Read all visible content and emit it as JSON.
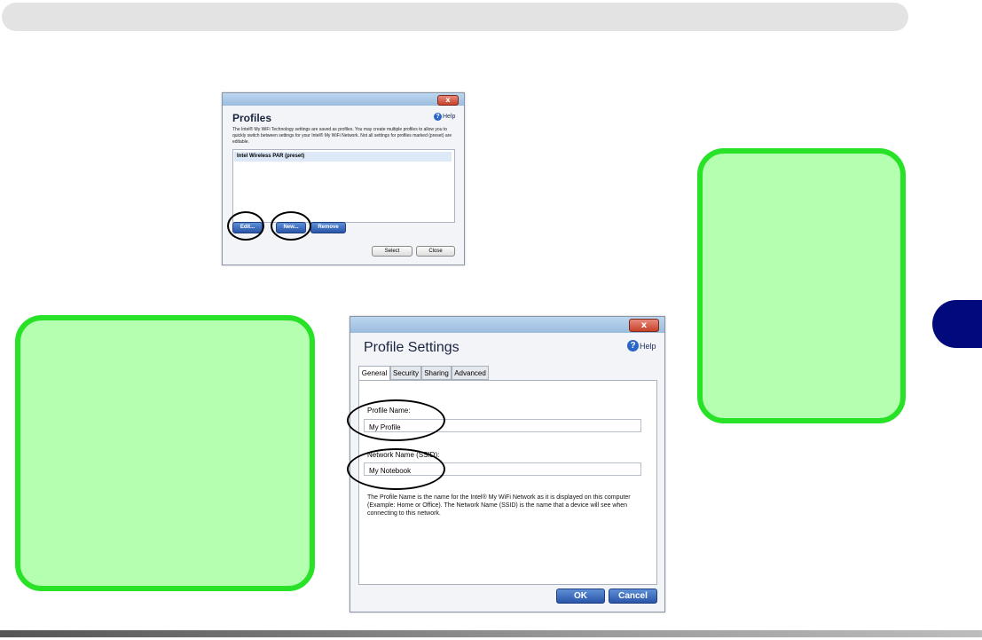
{
  "profiles_dialog": {
    "close_label": "x",
    "title": "Profiles",
    "help_label": "Help",
    "description": "The Intel® My WiFi Technology settings are saved as profiles. You may create multiple profiles to allow you to quickly switch between settings for your Intel® My WiFi Network. Not all settings for profiles marked (preset) are editable.",
    "list_items": [
      "Intel Wireless PAR (preset)"
    ],
    "buttons": {
      "edit": "Edit...",
      "new": "New...",
      "remove": "Remove",
      "select": "Select",
      "close": "Close"
    }
  },
  "profile_settings_dialog": {
    "close_label": "x",
    "title": "Profile Settings",
    "help_label": "Help",
    "tabs": [
      "General",
      "Security",
      "Sharing",
      "Advanced"
    ],
    "profile_name_label": "Profile Name:",
    "profile_name_value": "My Profile",
    "network_name_label": "Network Name (SSID):",
    "network_name_value": "My Notebook",
    "description": "The Profile Name is the name for the Intel® My WiFi Network as it is displayed on this computer (Example: Home or Office). The Network Name (SSID) is the name that a device will see when connecting to this network.",
    "buttons": {
      "ok": "OK",
      "cancel": "Cancel"
    }
  },
  "colors": {
    "callout_fill": "#b4ffb0",
    "callout_border": "#27e227",
    "chapter_tab": "#000a7a"
  }
}
